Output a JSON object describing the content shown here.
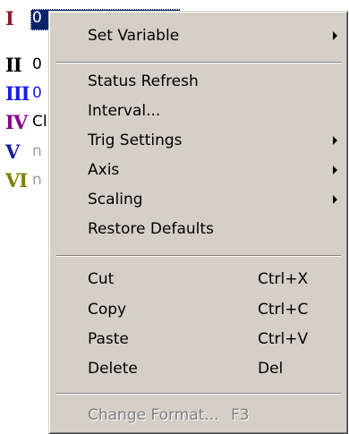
{
  "channels": [
    {
      "roman": "I",
      "value": "0",
      "color": "#8b1a2b",
      "value_color": "#ffffff"
    },
    {
      "roman": "II",
      "value": "0",
      "color": "#000000",
      "value_color": "#000000"
    },
    {
      "roman": "III",
      "value": "0",
      "color": "#1a1ae6",
      "value_color": "#1a1ae6"
    },
    {
      "roman": "IV",
      "value": "Cl",
      "color": "#8b008b",
      "value_color": "#000000"
    },
    {
      "roman": "V",
      "value": "n",
      "color": "#1a1a9c",
      "value_color": "#a0a0a0"
    },
    {
      "roman": "VI",
      "value": "n",
      "color": "#808000",
      "value_color": "#a0a0a0"
    }
  ],
  "menu": {
    "set_variable": "Set Variable",
    "status_refresh": "Status Refresh",
    "interval": "Interval...",
    "trig_settings": "Trig Settings",
    "axis": "Axis",
    "scaling": "Scaling",
    "restore_defaults": "Restore Defaults",
    "cut": {
      "label": "Cut",
      "shortcut": "Ctrl+X"
    },
    "copy": {
      "label": "Copy",
      "shortcut": "Ctrl+C"
    },
    "paste": {
      "label": "Paste",
      "shortcut": "Ctrl+V"
    },
    "delete": {
      "label": "Delete",
      "shortcut": "Del"
    },
    "change_format": {
      "label": "Change Format...",
      "shortcut": "F3",
      "enabled": false
    }
  },
  "icons": {
    "submenu": "submenu-arrow-icon"
  },
  "colors": {
    "menu_bg": "#d4d0c8",
    "selection": "#0a246a",
    "disabled_text": "#808080"
  }
}
